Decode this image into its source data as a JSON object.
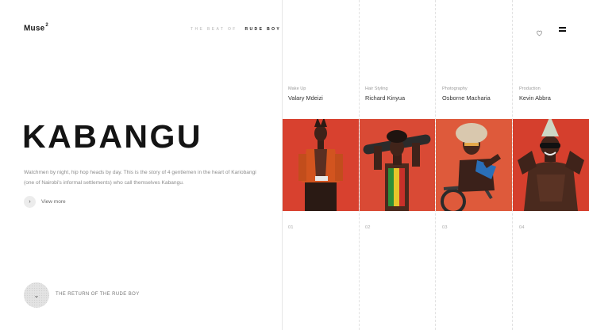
{
  "brand": {
    "name": "Muse",
    "superscript": "2"
  },
  "topnav": {
    "prefix": "THE BEAT OF",
    "current": "RUDE BOY"
  },
  "header_icons": {
    "heart": "heart-icon",
    "menu": "hamburger-menu-icon"
  },
  "hero": {
    "title": "KABANGU",
    "description": "Watchmen by night, hip hop heads by day. This is the story of 4 gentlemen in the heart of Kariobangi (one of Nairobi's informal settlements) who call themselves Kabangu.",
    "view_more": "View more"
  },
  "scroll": {
    "label": "THE RETURN OF THE RUDE BOY",
    "icon": "chevron-down-icon"
  },
  "credits": [
    {
      "role": "Make Up",
      "name": "Valary Mdeizi",
      "number": "01"
    },
    {
      "role": "Hair Styling",
      "name": "Richard Kinyua",
      "number": "02"
    },
    {
      "role": "Photography",
      "name": "Osborne Macharia",
      "number": "03"
    },
    {
      "role": "Production",
      "name": "Kevin Abbra",
      "number": "04"
    }
  ],
  "colors": {
    "accent_red": "#d8412f",
    "text": "#1a1a1a",
    "muted": "#8c8c8c"
  }
}
